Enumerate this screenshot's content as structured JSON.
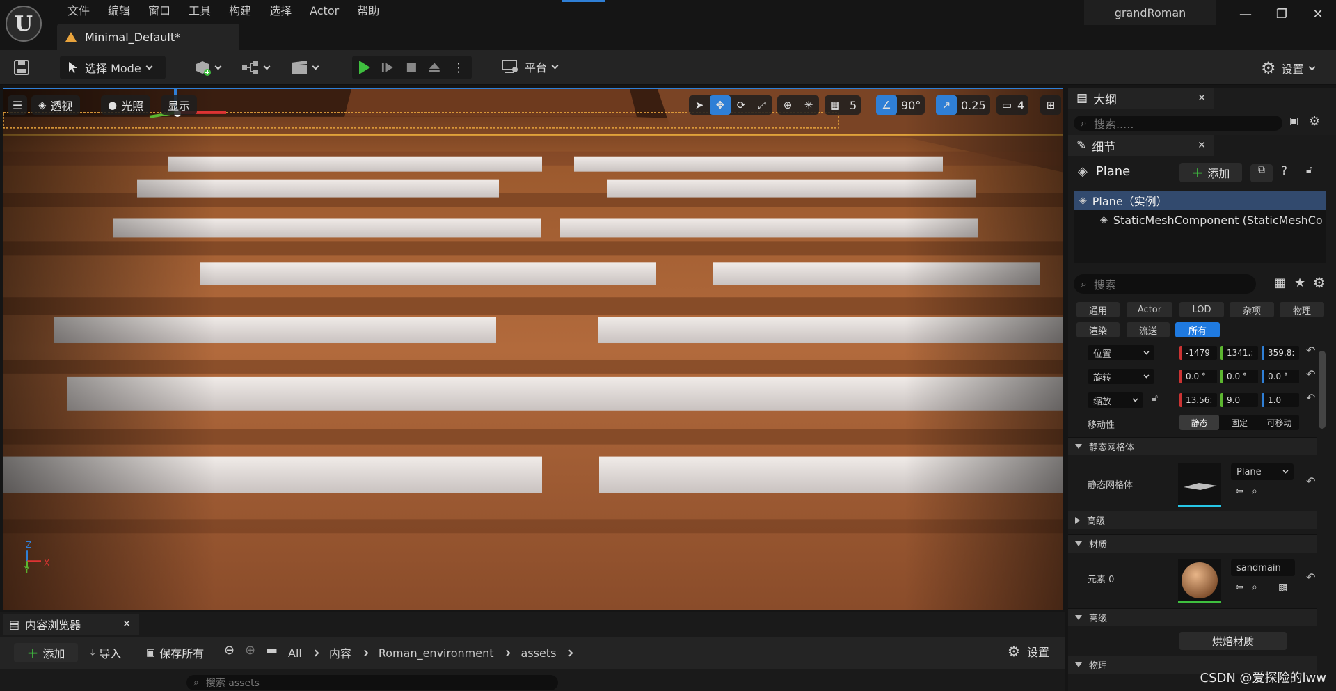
{
  "app": {
    "logo": "U",
    "menu": [
      "文件",
      "编辑",
      "窗口",
      "工具",
      "构建",
      "选择",
      "Actor",
      "帮助"
    ],
    "level_tab": "Minimal_Default*",
    "project": "grandRoman",
    "window_buttons": [
      "—",
      "❐",
      "✕"
    ]
  },
  "toolbar": {
    "mode": "选择 Mode",
    "platform": "平台",
    "settings": "设置"
  },
  "viewport": {
    "perspective": "透视",
    "lighting": "光照",
    "show": "显示",
    "grid_snap": "5",
    "rotation_snap": "90°",
    "scale_snap": "0.25",
    "camera_speed": "4",
    "axis_labels": {
      "z": "Z",
      "x": "X",
      "y": "Y"
    }
  },
  "outliner": {
    "title": "大纲",
    "search_placeholder": "搜索....."
  },
  "details": {
    "title": "细节",
    "object_name": "Plane",
    "add_button": "添加",
    "tree_root": "Plane（实例）",
    "tree_child": "StaticMeshComponent (StaticMeshCo",
    "search_placeholder": "搜索",
    "categories_row1": [
      "通用",
      "Actor",
      "LOD",
      "杂项",
      "物理"
    ],
    "categories_row2": [
      "渲染",
      "流送",
      "所有"
    ],
    "transform": {
      "location_label": "位置",
      "location": [
        "-1479",
        "1341.:",
        "359.8:"
      ],
      "rotation_label": "旋转",
      "rotation": [
        "0.0 °",
        "0.0 °",
        "0.0 °"
      ],
      "scale_label": "缩放",
      "scale": [
        "13.56:",
        "9.0",
        "1.0"
      ],
      "mobility_label": "移动性",
      "mobility": [
        "静态",
        "固定",
        "可移动"
      ]
    },
    "static_mesh_section": "静态网格体",
    "static_mesh_label": "静态网格体",
    "static_mesh_value": "Plane",
    "advanced_1": "高级",
    "materials_section": "材质",
    "element_label": "元素 0",
    "material_value": "sandmain",
    "advanced_2": "高级",
    "bake_button": "烘焙材质",
    "physics_section": "物理"
  },
  "content_browser": {
    "title": "内容浏览器",
    "add": "添加",
    "import": "导入",
    "save_all": "保存所有",
    "breadcrumbs": [
      "All",
      "内容",
      "Roman_environment",
      "assets"
    ],
    "settings": "设置",
    "search_placeholder": "搜索 assets"
  },
  "watermark": "CSDN @爱探险的lww"
}
